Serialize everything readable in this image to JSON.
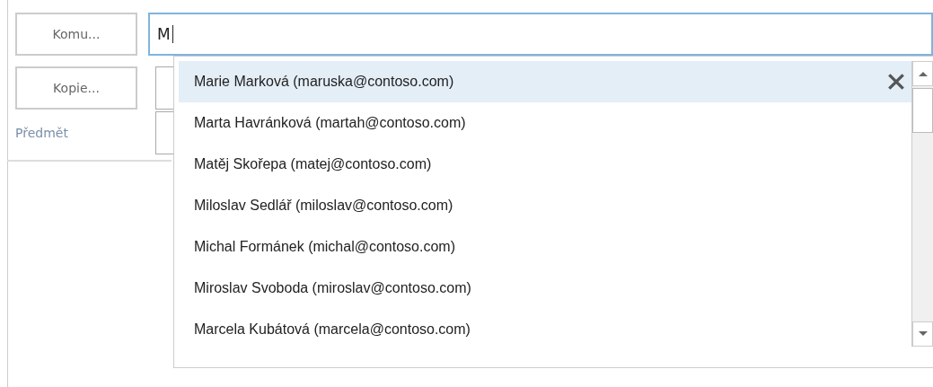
{
  "header": {
    "to_button": "Komu...",
    "cc_button": "Kopie...",
    "subject_label": "Předmět"
  },
  "to_field": {
    "value": "M"
  },
  "suggestions": [
    {
      "text": "Marie Marková (maruska@contoso.com)",
      "selected": true
    },
    {
      "text": "Marta Havránková (martah@contoso.com)",
      "selected": false
    },
    {
      "text": "Matěj Skořepa (matej@contoso.com)",
      "selected": false
    },
    {
      "text": "Miloslav Sedlář (miloslav@contoso.com)",
      "selected": false
    },
    {
      "text": "Michal Formánek (michal@contoso.com)",
      "selected": false
    },
    {
      "text": "Miroslav Svoboda (miroslav@contoso.com)",
      "selected": false
    },
    {
      "text": "Marcela Kubátová (marcela@contoso.com)",
      "selected": false
    }
  ]
}
